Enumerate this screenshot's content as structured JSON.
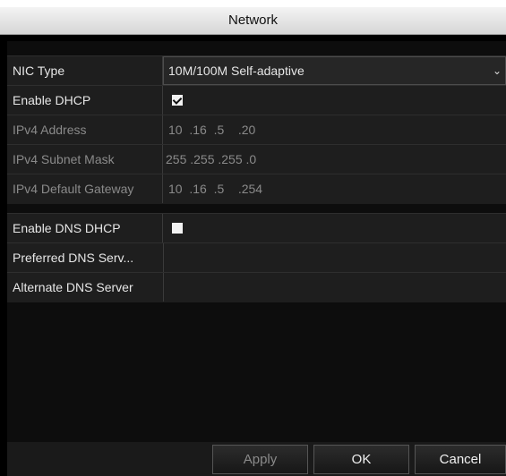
{
  "window": {
    "title": "Network"
  },
  "fields": {
    "nic_type": {
      "label": "NIC Type",
      "value": "10M/100M Self-adaptive",
      "chevron": "⌄"
    },
    "enable_dhcp": {
      "label": "Enable DHCP",
      "checked": true
    },
    "ipv4_address": {
      "label": "IPv4 Address",
      "value": "10  .16  .5    .20"
    },
    "ipv4_subnet": {
      "label": "IPv4 Subnet Mask",
      "value": "255 .255 .255 .0"
    },
    "ipv4_gateway": {
      "label": "IPv4 Default Gateway",
      "value": "10  .16  .5    .254"
    },
    "enable_dns_dhcp": {
      "label": "Enable DNS DHCP",
      "checked": false
    },
    "preferred_dns": {
      "label": "Preferred DNS Serv...",
      "value": ""
    },
    "alternate_dns": {
      "label": "Alternate DNS Server",
      "value": ""
    }
  },
  "buttons": {
    "apply": "Apply",
    "ok": "OK",
    "cancel": "Cancel"
  },
  "colors": {
    "enabled_text": "#e6e6e6",
    "disabled_text": "#8a8a8a",
    "apply_disabled": "#8a8a8a"
  }
}
